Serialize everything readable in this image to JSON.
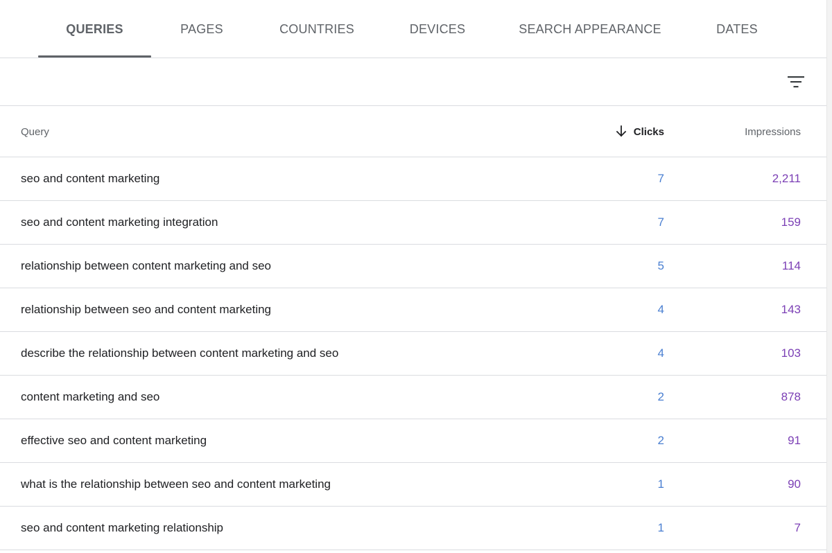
{
  "tabs": [
    {
      "label": "QUERIES",
      "active": true
    },
    {
      "label": "PAGES",
      "active": false
    },
    {
      "label": "COUNTRIES",
      "active": false
    },
    {
      "label": "DEVICES",
      "active": false
    },
    {
      "label": "SEARCH APPEARANCE",
      "active": false
    },
    {
      "label": "DATES",
      "active": false
    }
  ],
  "toolbar": {
    "filter_icon": "filter-icon"
  },
  "table": {
    "columns": {
      "query": "Query",
      "clicks": "Clicks",
      "impressions": "Impressions"
    },
    "sort": {
      "column": "clicks",
      "direction": "descending",
      "icon": "arrow-down-icon"
    },
    "rows": [
      {
        "query": "seo and content marketing",
        "clicks": "7",
        "impressions": "2,211"
      },
      {
        "query": "seo and content marketing integration",
        "clicks": "7",
        "impressions": "159"
      },
      {
        "query": "relationship between content marketing and seo",
        "clicks": "5",
        "impressions": "114"
      },
      {
        "query": "relationship between seo and content marketing",
        "clicks": "4",
        "impressions": "143"
      },
      {
        "query": "describe the relationship between content marketing and seo",
        "clicks": "4",
        "impressions": "103"
      },
      {
        "query": "content marketing and seo",
        "clicks": "2",
        "impressions": "878"
      },
      {
        "query": "effective seo and content marketing",
        "clicks": "2",
        "impressions": "91"
      },
      {
        "query": "what is the relationship between seo and content marketing",
        "clicks": "1",
        "impressions": "90"
      },
      {
        "query": "seo and content marketing relationship",
        "clicks": "1",
        "impressions": "7"
      }
    ]
  },
  "colors": {
    "clicks": "#4a7fd1",
    "impressions": "#7b3fb5",
    "active_tab": "#5f6368",
    "divider": "#dadce0"
  }
}
